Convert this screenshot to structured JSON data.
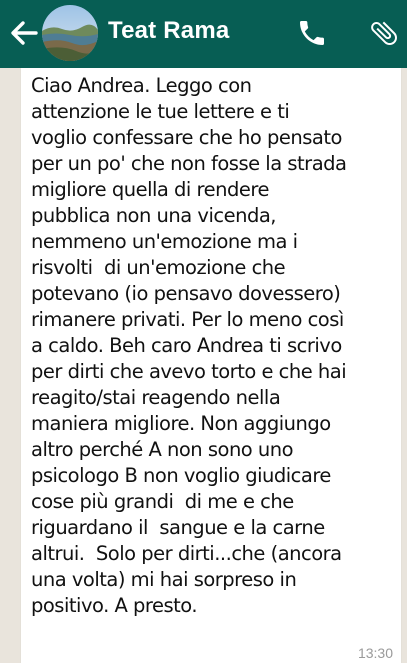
{
  "header": {
    "contact_name": "Teat Rama",
    "background_color": "#075e54",
    "icons": {
      "back": "arrow-left-icon",
      "avatar": "landscape-avatar",
      "call": "phone-icon",
      "attach": "paperclip-icon"
    }
  },
  "message": {
    "text": "Ciao Andrea. Leggo con\nattenzione le tue lettere e ti\nvoglio confessare che ho pensato\nper un po' che non fosse la strada\nmigliore quella di rendere\npubblica non una vicenda,\nnemmeno un'emozione ma i\nrisvolti  di un'emozione che\npotevano (io pensavo dovessero)\nrimanere privati. Per lo meno così\na caldo. Beh caro Andrea ti scrivo\nper dirti che avevo torto e che hai\nreagito/stai reagendo nella\nmaniera migliore. Non aggiungo\naltro perché A non sono uno\npsicologo B non voglio giudicare\ncose più grandi  di me e che\nriguardano il  sangue e la carne\naltrui.  Solo per dirti...che (ancora\nuna volta) mi hai sorpreso in\npositivo. A presto.",
    "time": "13:30"
  }
}
